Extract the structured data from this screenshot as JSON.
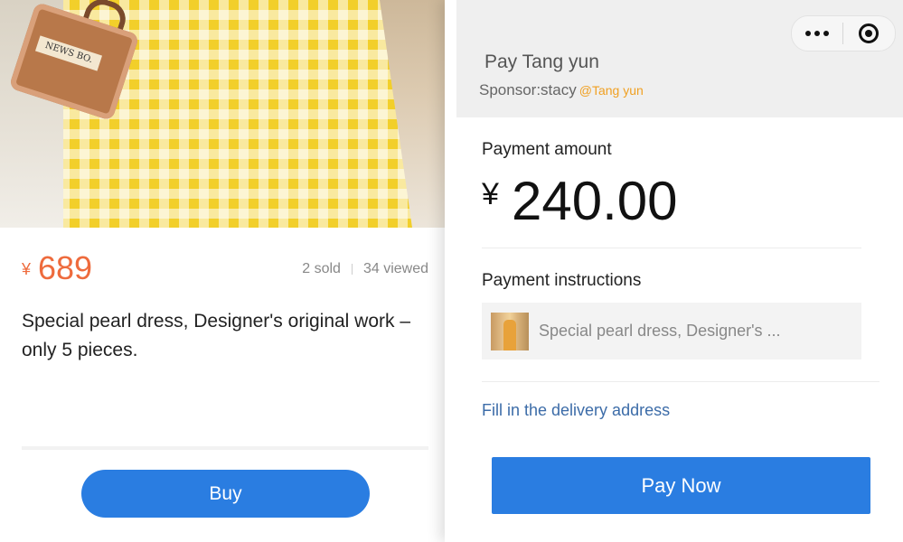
{
  "product": {
    "image_alt": "Yellow gingham dress with brown bag",
    "bag_print": "NEWS BO.",
    "currency_symbol": "¥",
    "price": "689",
    "sold": "2 sold",
    "viewed": "34 viewed",
    "title": "Special pearl  dress, Designer's original work – only 5 pieces.",
    "buy_label": "Buy",
    "accent_color": "#ee6b3d",
    "button_color": "#2a7de1"
  },
  "payment": {
    "pay_to": "Pay Tang yun",
    "sponsor_label": "Sponsor:stacy",
    "sponsor_handle": "@Tang yun",
    "amount_label": "Payment amount",
    "currency_symbol": "¥",
    "amount": "240.00",
    "instructions_label": "Payment instructions",
    "instructions_text": "Special pearl  dress, Designer's ...",
    "address_link": "Fill in the delivery address",
    "pay_now_label": "Pay Now",
    "link_color": "#3c6ca8",
    "handle_color": "#f0a022"
  },
  "capsule": {
    "more_icon": "more-dots-icon",
    "close_icon": "target-close-icon"
  }
}
